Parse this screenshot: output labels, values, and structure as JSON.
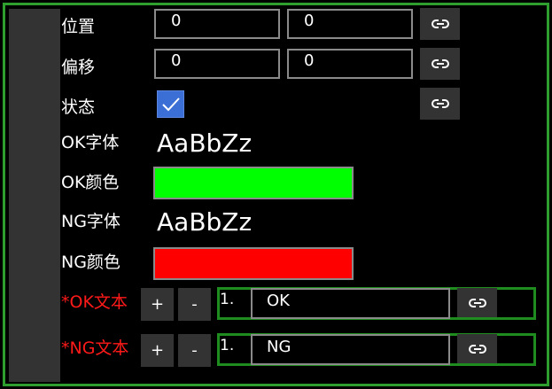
{
  "labels": {
    "position": "位置",
    "offset": "偏移",
    "state": "状态",
    "ok_font": "OK字体",
    "ok_color": "OK颜色",
    "ng_font": "NG字体",
    "ng_color": "NG颜色",
    "ok_text": "*OK文本",
    "ng_text": "*NG文本"
  },
  "position": {
    "x": "0",
    "y": "0"
  },
  "offset": {
    "x": "0",
    "y": "0"
  },
  "state": {
    "checked": true
  },
  "ok_font_sample": "AaBbZz",
  "ng_font_sample": "AaBbZz",
  "colors": {
    "ok": "#00ff00",
    "ng": "#ff0000",
    "frame": "#2e9e2e",
    "required_label": "#ff1a1a"
  },
  "buttons": {
    "plus": "+",
    "minus": "-"
  },
  "ok_list": {
    "index": "1.",
    "value": "OK"
  },
  "ng_list": {
    "index": "1.",
    "value": "NG"
  },
  "icons": {
    "link": "link-icon",
    "check": "check-icon"
  }
}
